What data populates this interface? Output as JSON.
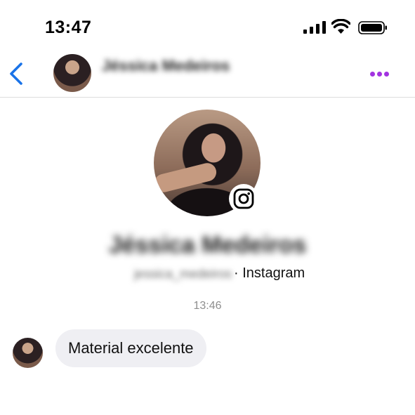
{
  "status_bar": {
    "time": "13:47",
    "icons": [
      "cellular-signal-icon",
      "wifi-icon",
      "battery-icon"
    ]
  },
  "header": {
    "back_icon": "chevron-left-icon",
    "contact_name": "Jéssica Medeiros",
    "more_icon": "more-dots-icon",
    "accent_color": "#1a73e8",
    "more_color": "#a233e0"
  },
  "profile": {
    "name": "Jéssica Medeiros",
    "username": "jessica_medeiros",
    "source_label": "· Instagram",
    "badge_icon": "instagram-icon"
  },
  "conversation": {
    "timestamp": "13:46",
    "messages": [
      {
        "text": "Material excelente",
        "incoming": true
      }
    ],
    "bubble_color": "#efeff3"
  }
}
